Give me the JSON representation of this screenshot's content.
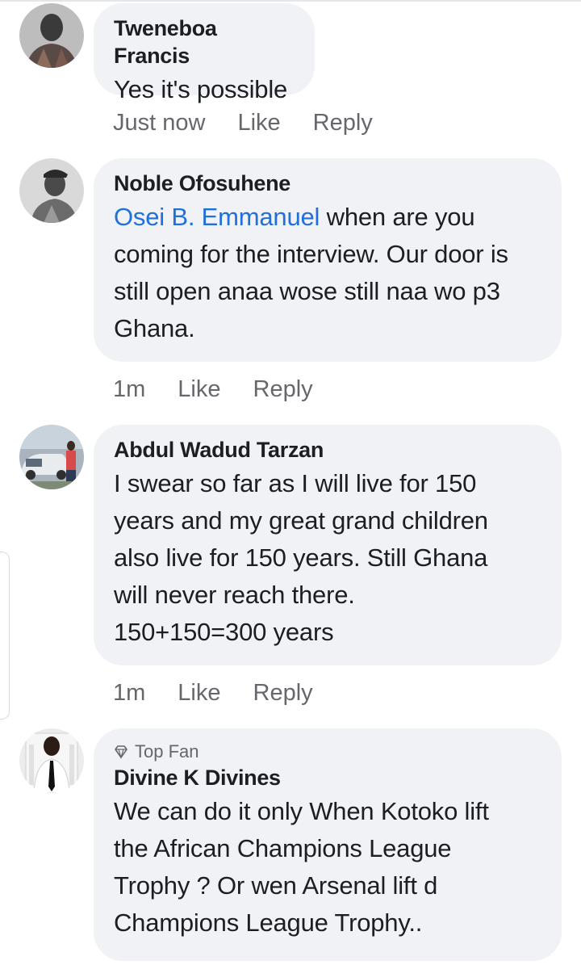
{
  "comments": [
    {
      "author": "Tweneboa Francis",
      "text": "Yes it's possible",
      "time": "Just now",
      "like_label": "Like",
      "reply_label": "Reply"
    },
    {
      "author": "Noble Ofosuhene",
      "mention": "Osei B. Emmanuel",
      "text_after_mention": " when are you coming for the interview. Our door is still open anaa wose still naa wo p3 Ghana.",
      "time": "1m",
      "like_label": "Like",
      "reply_label": "Reply"
    },
    {
      "author": "Abdul Wadud Tarzan",
      "text_lines": [
        "I swear so far as I will live for 150",
        "years and my great grand children",
        "also live for 150 years. Still Ghana",
        "will never reach there.",
        "150+150=300 years"
      ],
      "time": "1m",
      "like_label": "Like",
      "reply_label": "Reply"
    },
    {
      "badge": "Top Fan",
      "author": "Divine K Divines",
      "text_lines": [
        "We can do it only When Kotoko lift",
        "the African Champions League",
        "Trophy ? Or wen Arsenal lift d",
        "Champions League Trophy.."
      ]
    }
  ],
  "colors": {
    "bubble": "#f0f2f5",
    "mention": "#216fdb",
    "meta": "#65676b",
    "text": "#1c1e21"
  }
}
